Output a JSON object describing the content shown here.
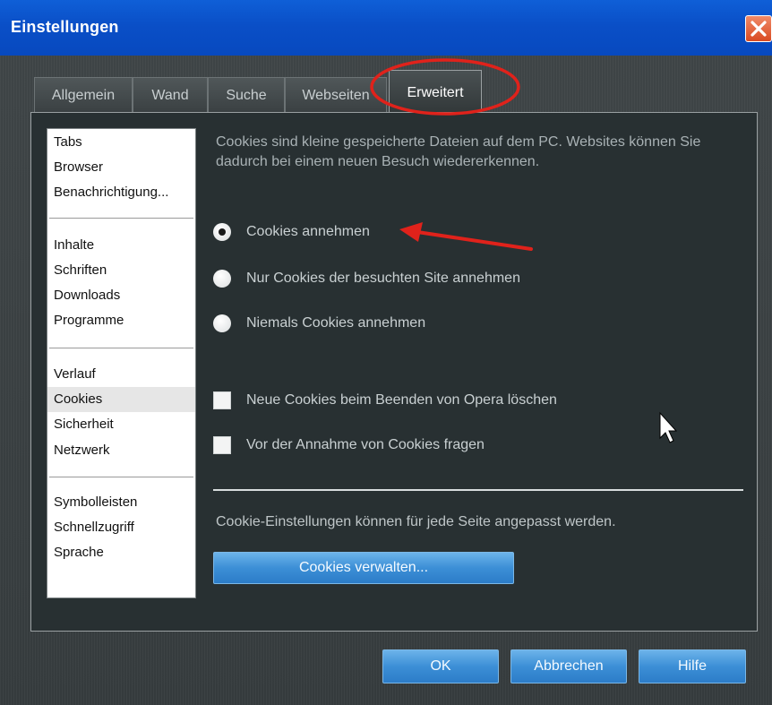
{
  "window": {
    "title": "Einstellungen"
  },
  "tabs": [
    {
      "label": "Allgemein"
    },
    {
      "label": "Wand"
    },
    {
      "label": "Suche"
    },
    {
      "label": "Webseiten"
    },
    {
      "label": "Erweitert",
      "active": true
    }
  ],
  "sidebar": {
    "groups": [
      [
        "Tabs",
        "Browser",
        "Benachrichtigung..."
      ],
      [
        "Inhalte",
        "Schriften",
        "Downloads",
        "Programme"
      ],
      [
        "Verlauf",
        "Cookies",
        "Sicherheit",
        "Netzwerk"
      ],
      [
        "Symbolleisten",
        "Schnellzugriff",
        "Sprache"
      ]
    ],
    "selected": "Cookies"
  },
  "cookies": {
    "description": "Cookies sind kleine gespeicherte Dateien auf dem PC. Websites können Sie dadurch bei einem neuen Besuch wiedererkennen.",
    "radio_options": [
      {
        "label": "Cookies annehmen",
        "selected": true
      },
      {
        "label": "Nur Cookies der besuchten Site annehmen",
        "selected": false
      },
      {
        "label": "Niemals Cookies annehmen",
        "selected": false
      }
    ],
    "checkboxes": [
      {
        "label": "Neue Cookies beim Beenden von Opera löschen",
        "checked": false
      },
      {
        "label": "Vor der Annahme von Cookies fragen",
        "checked": false
      }
    ],
    "hint": "Cookie-Einstellungen können für jede Seite angepasst werden.",
    "manage_button": "Cookies verwalten..."
  },
  "footer": {
    "ok": "OK",
    "cancel": "Abbrechen",
    "help": "Hilfe"
  },
  "colors": {
    "titlebar": "#0a4fc7",
    "annotation_red": "#e0221b",
    "button_blue": "#3c8fd6"
  }
}
